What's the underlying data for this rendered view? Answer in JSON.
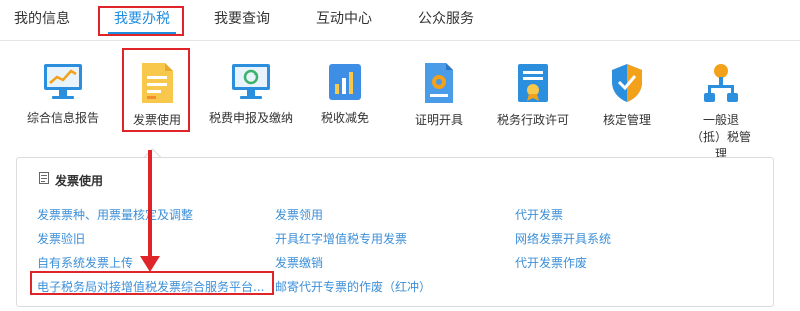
{
  "tabs": [
    {
      "label": "我的信息"
    },
    {
      "label": "我要办税"
    },
    {
      "label": "我要查询"
    },
    {
      "label": "互动中心"
    },
    {
      "label": "公众服务"
    }
  ],
  "function_icons": [
    {
      "label": "综合信息报告",
      "icon": "monitor-chart-icon"
    },
    {
      "label": "发票使用",
      "icon": "invoice-document-icon"
    },
    {
      "label": "税费申报及缴纳",
      "icon": "monitor-refresh-icon"
    },
    {
      "label": "税收减免",
      "icon": "bar-chart-card-icon"
    },
    {
      "label": "证明开具",
      "icon": "certificate-gear-icon"
    },
    {
      "label": "税务行政许可",
      "icon": "license-badge-icon"
    },
    {
      "label": "核定管理",
      "icon": "shield-check-icon"
    },
    {
      "label": "一般退（抵）税管理",
      "icon": "network-nodes-icon"
    }
  ],
  "panel": {
    "title": "发票使用",
    "links": [
      "发票票种、用票量核定及调整",
      "发票领用",
      "代开发票",
      "发票验旧",
      "开具红字增值税专用发票",
      "网络发票开具系统",
      "自有系统发票上传",
      "发票缴销",
      "代开发票作废",
      "电子税务局对接增值税发票综合服务平台...",
      "邮寄代开专票的作废（红冲）"
    ]
  },
  "colors": {
    "accent_blue": "#1f8de0",
    "link_blue": "#3c8fd8",
    "highlight_red": "#e0252a"
  }
}
